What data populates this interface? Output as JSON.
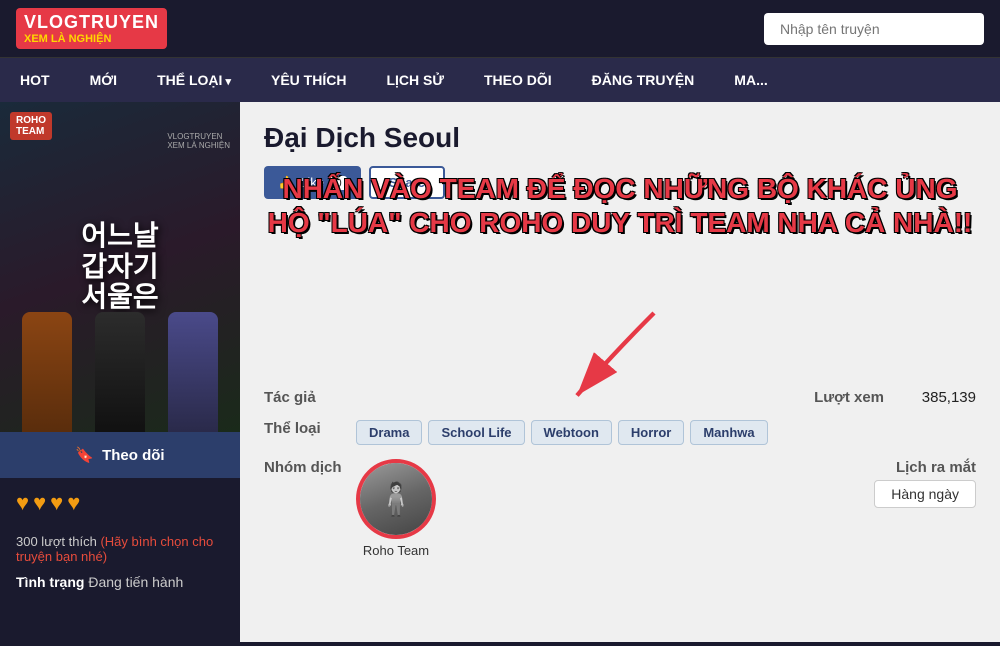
{
  "site": {
    "name": "VLOGTRUYEN",
    "tagline": "XEM LÀ NGHIỆN",
    "search_placeholder": "Nhập tên truyện"
  },
  "nav": {
    "items": [
      {
        "label": "HOT",
        "has_arrow": false
      },
      {
        "label": "MỚI",
        "has_arrow": false
      },
      {
        "label": "THỂ LOẠI",
        "has_arrow": true
      },
      {
        "label": "YÊU THÍCH",
        "has_arrow": false
      },
      {
        "label": "LỊCH SỬ",
        "has_arrow": false
      },
      {
        "label": "THEO DÕI",
        "has_arrow": false
      },
      {
        "label": "ĐĂNG TRUYỆN",
        "has_arrow": false
      },
      {
        "label": "MA...",
        "has_arrow": false
      }
    ]
  },
  "manga": {
    "title": "Đại Dịch Seoul",
    "like_label": "Like",
    "like_count": "0",
    "share_label": "Share",
    "follow_label": "Theo dõi",
    "promo_line1": "NHẤN VÀO TEAM ĐỂ ĐỌC NHỮNG BỘ KHÁC ỦNG",
    "promo_line2": "HỘ \"LÚA\" CHO ROHO DUY TRÌ TEAM NHA CẢ NHÀ!!",
    "author_label": "Tác giả",
    "author_value": "",
    "genre_label": "Thể loại",
    "genres": [
      "Drama",
      "School Life",
      "Webtoon",
      "Horror",
      "Manhwa"
    ],
    "translator_label": "Nhóm dịch",
    "translator_name": "Roho Team",
    "views_label": "Lượt xem",
    "views_count": "385,139",
    "schedule_label": "Lịch ra mắt",
    "schedule_value": "Hàng ngày",
    "rating_hearts": "♥♥♥♥",
    "rating_count": "300 lượt thích",
    "rating_hint": "(Hãy bình chọn cho truyện bạn nhé)",
    "status_label": "Tình trạng",
    "status_value": "Đang tiến hành",
    "cover_text": "어느날\n갑자기\n서울은"
  }
}
